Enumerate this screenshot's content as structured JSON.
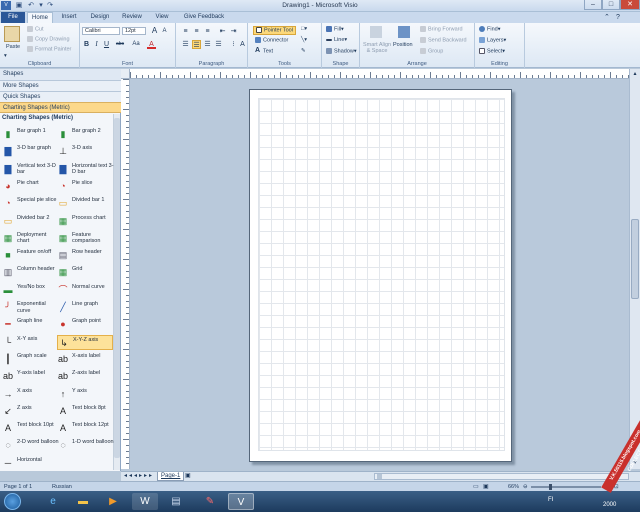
{
  "window": {
    "title": "Drawing1 - Microsoft Visio"
  },
  "tabs": [
    "File",
    "Home",
    "Insert",
    "Design",
    "Review",
    "View",
    "Give Feedback"
  ],
  "ribbon": {
    "clipboard": {
      "paste": "Paste",
      "cut": "Cut",
      "copy": "Copy Drawing",
      "format_painter": "Format Painter",
      "label": "Clipboard"
    },
    "font": {
      "name": "Calibri",
      "size": "12pt",
      "grow": "A",
      "shrink": "A",
      "bold": "B",
      "italic": "I",
      "underline": "U",
      "strike": "abc",
      "case": "Aa",
      "color": "A",
      "label": "Font"
    },
    "paragraph": {
      "label": "Paragraph"
    },
    "tools": {
      "pointer": "Pointer Tool",
      "connector": "Connector",
      "text": "Text",
      "label": "Tools"
    },
    "shape": {
      "fill": "Fill",
      "line": "Line",
      "shadow": "Shadow",
      "label": "Shape"
    },
    "arrange": {
      "smart_align": "Smart Align & Space",
      "position": "Position",
      "bring_forward": "Bring Forward",
      "send_backward": "Send Backward",
      "group": "Group",
      "label": "Arrange"
    },
    "editing": {
      "find": "Find",
      "layers": "Layers",
      "select": "Select",
      "label": "Editing"
    }
  },
  "shapes_pane": {
    "header": "Shapes",
    "more_shapes": "More Shapes",
    "quick_shapes": "Quick Shapes",
    "active_stencil": "Charting Shapes (Metric)",
    "stencil_title": "Charting Shapes (Metric)",
    "items": [
      {
        "label": "Bar graph 1",
        "icon": "bar-graph-icon"
      },
      {
        "label": "Bar graph 2",
        "icon": "bar-graph-icon"
      },
      {
        "label": "3-D bar graph",
        "icon": "3d-bar-icon"
      },
      {
        "label": "3-D axis",
        "icon": "3d-axis-icon"
      },
      {
        "label": "Vertical text 3-D bar",
        "icon": "3d-bar-icon"
      },
      {
        "label": "Horizontal text 3-D bar",
        "icon": "3d-bar-icon"
      },
      {
        "label": "Pie chart",
        "icon": "pie-chart-icon"
      },
      {
        "label": "Pie slice",
        "icon": "pie-slice-icon"
      },
      {
        "label": "Special pie slice",
        "icon": "pie-slice-icon"
      },
      {
        "label": "Divided bar 1",
        "icon": "divided-bar-icon"
      },
      {
        "label": "Divided bar 2",
        "icon": "divided-bar-icon"
      },
      {
        "label": "Process chart",
        "icon": "process-chart-icon"
      },
      {
        "label": "Deployment chart",
        "icon": "deployment-chart-icon"
      },
      {
        "label": "Feature comparison",
        "icon": "feature-comparison-icon"
      },
      {
        "label": "Feature on/off",
        "icon": "feature-toggle-icon"
      },
      {
        "label": "Row header",
        "icon": "row-header-icon"
      },
      {
        "label": "Column header",
        "icon": "column-header-icon"
      },
      {
        "label": "Grid",
        "icon": "grid-icon"
      },
      {
        "label": "Yes/No box",
        "icon": "yes-no-box-icon"
      },
      {
        "label": "Normal curve",
        "icon": "normal-curve-icon"
      },
      {
        "label": "Exponential curve",
        "icon": "exponential-curve-icon"
      },
      {
        "label": "Line graph",
        "icon": "line-graph-icon"
      },
      {
        "label": "Graph line",
        "icon": "graph-line-icon"
      },
      {
        "label": "Graph point",
        "icon": "graph-point-icon"
      },
      {
        "label": "X-Y axis",
        "icon": "xy-axis-icon"
      },
      {
        "label": "X-Y-Z axis",
        "icon": "xyz-axis-icon"
      },
      {
        "label": "Graph scale",
        "icon": "graph-scale-icon"
      },
      {
        "label": "X-axis label",
        "icon": "x-axis-label-icon"
      },
      {
        "label": "Y-axis label",
        "icon": "y-axis-label-icon"
      },
      {
        "label": "Z-axis label",
        "icon": "z-axis-label-icon"
      },
      {
        "label": "X axis",
        "icon": "x-axis-icon"
      },
      {
        "label": "Y axis",
        "icon": "y-axis-icon"
      },
      {
        "label": "Z axis",
        "icon": "z-axis-icon"
      },
      {
        "label": "Text block 8pt",
        "icon": "text-block-icon"
      },
      {
        "label": "Text block 10pt",
        "icon": "text-block-icon"
      },
      {
        "label": "Text block 12pt",
        "icon": "text-block-icon"
      },
      {
        "label": "2-D word balloon",
        "icon": "word-balloon-icon"
      },
      {
        "label": "1-D word balloon",
        "icon": "word-balloon-icon"
      },
      {
        "label": "Horizontal",
        "icon": "horizontal-icon"
      }
    ]
  },
  "page_tab": "Page-1",
  "status": {
    "page": "Page 1 of 1",
    "language": "Russian",
    "zoom": "66%"
  },
  "taskbar": {
    "clock": "2000"
  },
  "watermark": "V.K.50115.blogspot.com COLLECT",
  "colors": {
    "accent": "#2b5797",
    "selected_shape": "#fde29a",
    "pane_header_active": "#fcd88a"
  }
}
